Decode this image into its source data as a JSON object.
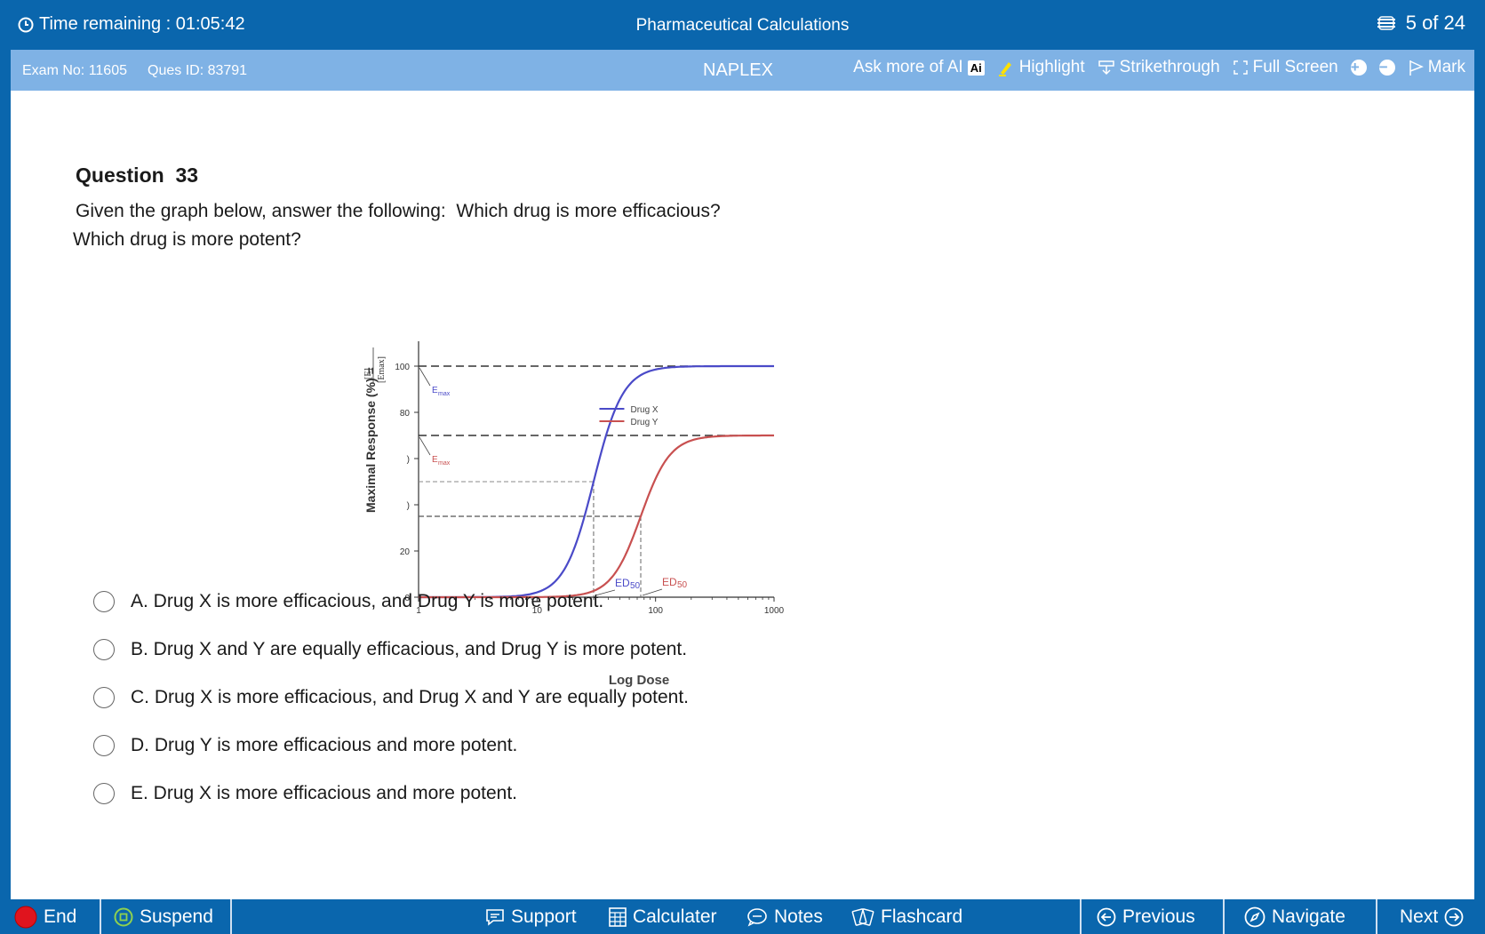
{
  "header": {
    "timer": "Time remaining : 01:05:42",
    "title": "Pharmaceutical Calculations",
    "progress": "5 of 24"
  },
  "subheader": {
    "exam_no": "Exam No: 11605",
    "ques_id": "Ques ID: 83791",
    "exam_name": "NAPLEX",
    "ask_ai": "Ask more of AI",
    "ai_badge": "Ai",
    "highlight": "Highlight",
    "strikethrough": "Strikethrough",
    "full_screen": "Full Screen",
    "zoom_in": "+",
    "zoom_out": "−",
    "mark": "Mark"
  },
  "question": {
    "heading": "Question  33",
    "text_part1": "Given the graph below, answer the following:",
    "text_part2": "Which drug is more efficacious?",
    "text_line2": "Which drug is more potent?"
  },
  "chart_data": {
    "type": "line",
    "xlabel": "Log Dose",
    "ylabel": "Maximal Response (%) = ",
    "ylabel_fraction_top": "[E]",
    "ylabel_fraction_bottom": "[Emax]",
    "x_scale": "log",
    "x_ticks": [
      "1",
      "10",
      "100",
      "1000"
    ],
    "y_ticks": [
      "0",
      "20",
      ")",
      ")",
      "80",
      "100"
    ],
    "ylim": [
      0,
      100
    ],
    "xlim": [
      1,
      1000
    ],
    "series": [
      {
        "name": "Drug X",
        "color": "#4a4ac8",
        "emax": 100,
        "ed50": 30,
        "hill": 3.5
      },
      {
        "name": "Drug Y",
        "color": "#c85050",
        "emax": 70,
        "ed50": 75,
        "hill": 3.5
      }
    ],
    "annotations": {
      "emax_label": "E",
      "emax_sub": "max",
      "ed50_label": "ED",
      "ed50_sub": "50"
    },
    "reference_lines": [
      100,
      70,
      50,
      35
    ]
  },
  "options": [
    {
      "label": "A. Drug X is more efficacious, and Drug Y is more potent."
    },
    {
      "label": "B. Drug X and Y are equally efficacious, and Drug Y is more potent."
    },
    {
      "label": "C. Drug X is more efficacious, and Drug X and Y are equally potent."
    },
    {
      "label": "D. Drug Y is more efficacious and more potent."
    },
    {
      "label": "E. Drug X is more efficacious and more potent."
    }
  ],
  "footer": {
    "end": "End",
    "suspend": "Suspend",
    "support": "Support",
    "calculator": "Calculater",
    "notes": "Notes",
    "flashcard": "Flashcard",
    "previous": "Previous",
    "navigate": "Navigate",
    "next": "Next"
  },
  "colors": {
    "primary": "#0a66ad",
    "subbar": "#7fb2e5",
    "end_red": "#e0141e",
    "suspend_green": "#8fd14f"
  }
}
